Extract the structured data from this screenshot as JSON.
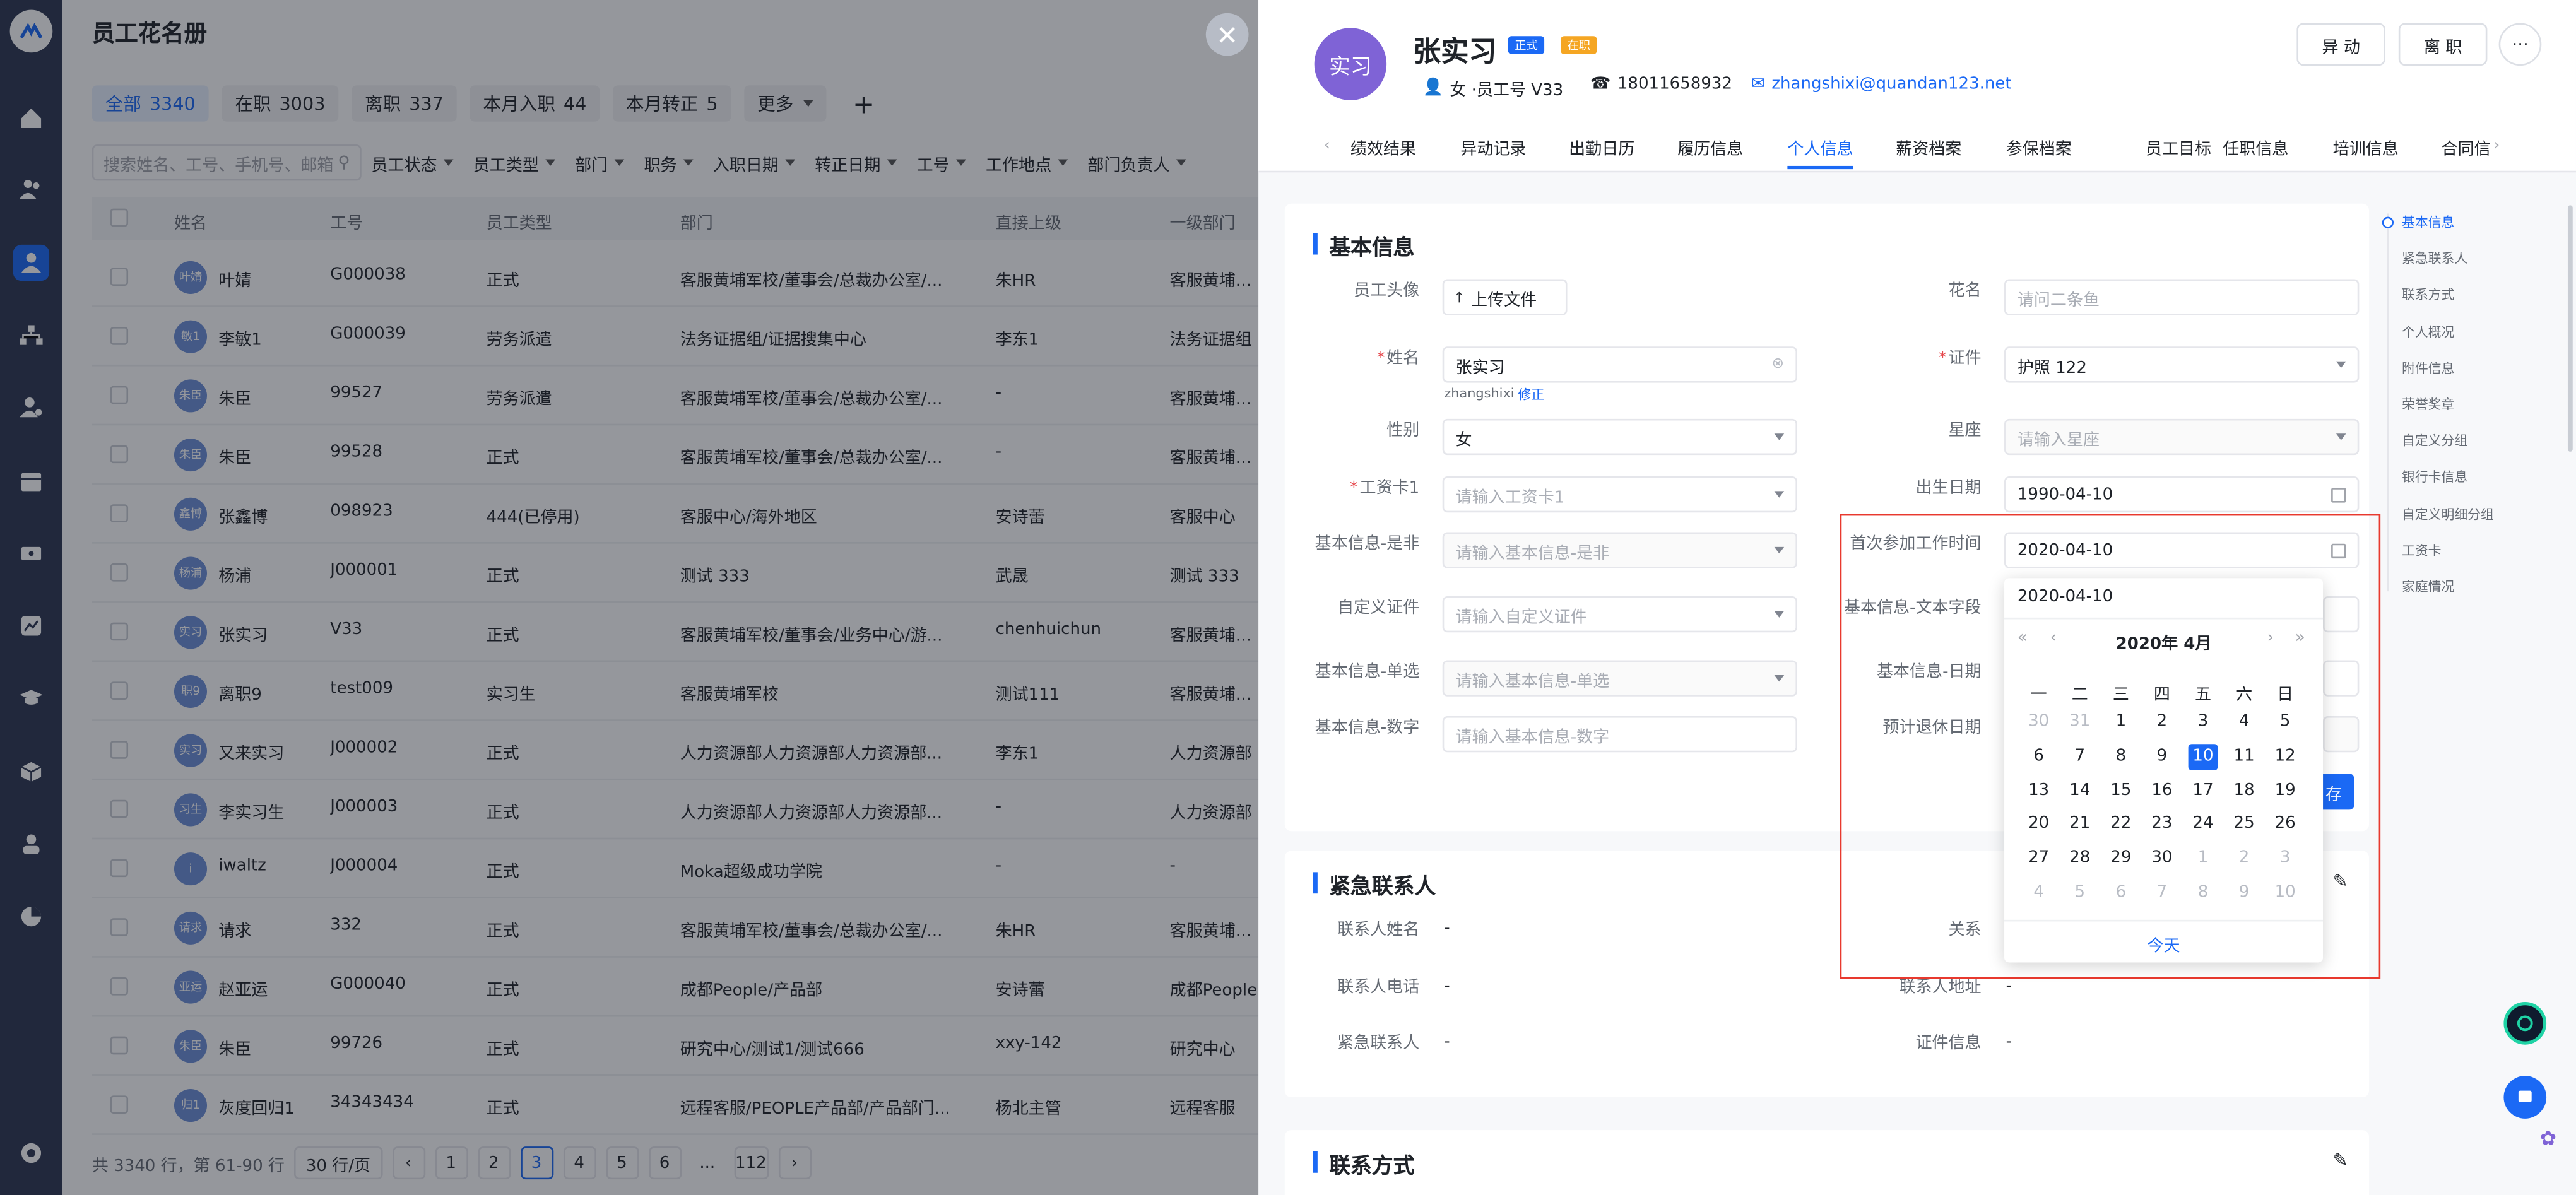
{
  "list": {
    "title": "员工花名册",
    "tabs": [
      {
        "label": "全部",
        "count": "3340"
      },
      {
        "label": "在职",
        "count": "3003"
      },
      {
        "label": "离职",
        "count": "337"
      },
      {
        "label": "本月入职",
        "count": "44"
      },
      {
        "label": "本月转正",
        "count": "5"
      },
      {
        "label": "更多",
        "count": ""
      }
    ],
    "add": "+",
    "search_placeholder": "搜索姓名、工号、手机号、邮箱",
    "filters": [
      "员工状态",
      "员工类型",
      "部门",
      "职务",
      "入职日期",
      "转正日期",
      "工号",
      "工作地点",
      "部门负责人"
    ],
    "columns": [
      "姓名",
      "工号",
      "员工类型",
      "部门",
      "直接上级",
      "一级部门"
    ],
    "rows": [
      {
        "av": "叶婧",
        "name": "叶婧",
        "id": "G000038",
        "type": "正式",
        "dept": "客服黄埔军校/董事会/总裁办公室/...",
        "mgr": "朱HR",
        "d1": "客服黄埔军校"
      },
      {
        "av": "敏1",
        "name": "李敏1",
        "id": "G000039",
        "type": "劳务派遣",
        "dept": "法务证据组/证据搜集中心",
        "mgr": "李东1",
        "d1": "法务证据组"
      },
      {
        "av": "朱臣",
        "name": "朱臣",
        "id": "99527",
        "type": "劳务派遣",
        "dept": "客服黄埔军校/董事会/总裁办公室/...",
        "mgr": "-",
        "d1": "客服黄埔军校"
      },
      {
        "av": "朱臣",
        "name": "朱臣",
        "id": "99528",
        "type": "正式",
        "dept": "客服黄埔军校/董事会/总裁办公室/...",
        "mgr": "-",
        "d1": "客服黄埔军校"
      },
      {
        "av": "鑫博",
        "name": "张鑫博",
        "id": "098923",
        "type": "444(已停用)",
        "dept": "客服中心/海外地区",
        "mgr": "安诗蕾",
        "d1": "客服中心"
      },
      {
        "av": "杨浦",
        "name": "杨浦",
        "id": "J000001",
        "type": "正式",
        "dept": "测试 333",
        "mgr": "武晟",
        "d1": "测试 333"
      },
      {
        "av": "实习",
        "name": "张实习",
        "id": "V33",
        "type": "正式",
        "dept": "客服黄埔军校/董事会/业务中心/游...",
        "mgr": "chenhuichun",
        "d1": "客服黄埔军校"
      },
      {
        "av": "职9",
        "name": "离职9",
        "id": "test009",
        "type": "实习生",
        "dept": "客服黄埔军校",
        "mgr": "测试111",
        "d1": "客服黄埔军校"
      },
      {
        "av": "实习",
        "name": "又来实习",
        "id": "J000002",
        "type": "正式",
        "dept": "人力资源部人力资源部人力资源部...",
        "mgr": "李东1",
        "d1": "人力资源部"
      },
      {
        "av": "习生",
        "name": "李实习生",
        "id": "J000003",
        "type": "正式",
        "dept": "人力资源部人力资源部人力资源部...",
        "mgr": "-",
        "d1": "人力资源部"
      },
      {
        "av": "i",
        "name": "iwaltz",
        "id": "J000004",
        "type": "正式",
        "dept": "Moka超级成功学院",
        "mgr": "-",
        "d1": "-"
      },
      {
        "av": "请求",
        "name": "请求",
        "id": "332",
        "type": "正式",
        "dept": "客服黄埔军校/董事会/总裁办公室/...",
        "mgr": "朱HR",
        "d1": "客服黄埔军校"
      },
      {
        "av": "亚运",
        "name": "赵亚运",
        "id": "G000040",
        "type": "正式",
        "dept": "成都People/产品部",
        "mgr": "安诗蕾",
        "d1": "成都People"
      },
      {
        "av": "朱臣",
        "name": "朱臣",
        "id": "99726",
        "type": "正式",
        "dept": "研究中心/测试1/测试666",
        "mgr": "xxy-142",
        "d1": "研究中心"
      },
      {
        "av": "归1",
        "name": "灰度回归1",
        "id": "34343434",
        "type": "正式",
        "dept": "远程客服/PEOPLE产品部/产品部门...",
        "mgr": "杨北主管",
        "d1": "远程客服"
      }
    ],
    "pager": {
      "summary": "共 3340 行，第 61-90 行",
      "page_size": "30 行/页",
      "pages": [
        "1",
        "2",
        "3",
        "4",
        "5",
        "6",
        "...",
        "112"
      ],
      "current": "3"
    }
  },
  "drawer": {
    "avatar": "实习",
    "name": "张实习",
    "tag1": "正式",
    "tag2": "在职",
    "gender_id": "女 ·员工号 V33",
    "phone": "18011658932",
    "email": "zhangshixi@quandan123.net",
    "btn_transfer": "异 动",
    "btn_leave": "离 职",
    "btn_more": "⋯",
    "tabs": [
      "绩效结果",
      "异动记录",
      "出勤日历",
      "履历信息",
      "个人信息",
      "薪资档案",
      "参保档案",
      "员工目标",
      "任职信息",
      "培训信息",
      "合同信"
    ],
    "active_tab": "个人信息",
    "basic": {
      "title": "基本信息",
      "avatar_label": "员工头像",
      "upload": "上传文件",
      "nickname_label": "花名",
      "nickname_ph": "请问二条鱼",
      "name_label": "姓名",
      "name_val": "张实习",
      "pinyin": "zhangshixi",
      "fix": "修正",
      "cert_label": "证件",
      "cert_val": "护照 122",
      "gender_label": "性别",
      "gender_val": "女",
      "star_label": "星座",
      "star_ph": "请输入星座",
      "card_label": "工资卡1",
      "card_ph": "请输入工资卡1",
      "birth_label": "出生日期",
      "birth_val": "1990-04-10",
      "yn_label": "基本信息-是非",
      "yn_ph": "请输入基本信息-是非",
      "work_label": "首次参加工作时间",
      "work_val": "2020-04-10",
      "custom_label": "自定义证件",
      "custom_ph": "请输入自定义证件",
      "text_label": "基本信息-文本字段",
      "single_label": "基本信息-单选",
      "single_ph": "请输入基本信息-单选",
      "date_label": "基本信息-日期",
      "num_label": "基本信息-数字",
      "num_ph": "请输入基本信息-数字",
      "retire_label": "预计退休日期",
      "save": "存"
    },
    "emergency": {
      "title": "紧急联系人",
      "name_label": "联系人姓名",
      "name_val": "-",
      "rel_label": "关系",
      "phone_label": "联系人电话",
      "phone_val": "-",
      "addr_label": "联系人地址",
      "addr_val": "-",
      "ec_label": "紧急联系人",
      "ec_val": "-",
      "cert_label": "证件信息",
      "cert_val": "-"
    },
    "contact": {
      "title": "联系方式"
    },
    "anchors": [
      "基本信息",
      "紧急联系人",
      "联系方式",
      "个人概况",
      "附件信息",
      "荣誉奖章",
      "自定义分组",
      "银行卡信息",
      "自定义明细分组",
      "工资卡",
      "家庭情况"
    ]
  },
  "picker": {
    "input": "2020-04-10",
    "month": "2020年 4月",
    "weekdays": [
      "一",
      "二",
      "三",
      "四",
      "五",
      "六",
      "日"
    ],
    "weeks": [
      [
        "30",
        "31",
        "1",
        "2",
        "3",
        "4",
        "5"
      ],
      [
        "6",
        "7",
        "8",
        "9",
        "10",
        "11",
        "12"
      ],
      [
        "13",
        "14",
        "15",
        "16",
        "17",
        "18",
        "19"
      ],
      [
        "20",
        "21",
        "22",
        "23",
        "24",
        "25",
        "26"
      ],
      [
        "27",
        "28",
        "29",
        "30",
        "1",
        "2",
        "3"
      ],
      [
        "4",
        "5",
        "6",
        "7",
        "8",
        "9",
        "10"
      ]
    ],
    "selected": "10",
    "today": "今天"
  },
  "colors": {
    "accent": "#1b69f5",
    "highlight": "#e8392e"
  }
}
